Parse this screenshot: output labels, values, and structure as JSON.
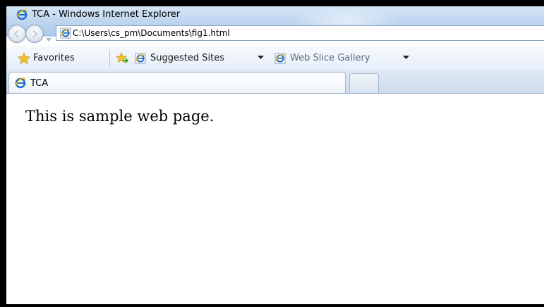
{
  "window": {
    "title": "TCA - Windows Internet Explorer"
  },
  "address_bar": {
    "url": "C:\\Users\\cs_pm\\Documents\\fig1.html"
  },
  "favorites_bar": {
    "favorites_label": "Favorites",
    "items": [
      {
        "label": "Suggested Sites",
        "icon": "ie-icon"
      },
      {
        "label": "Web Slice Gallery",
        "icon": "ie-icon"
      }
    ]
  },
  "tabs": [
    {
      "label": "TCA",
      "icon": "ie-icon",
      "active": true
    }
  ],
  "page": {
    "text": "This is sample web page."
  },
  "colors": {
    "titlebar": "#c0d7f0",
    "window_frame": "#000000",
    "content_background": "#ffffff"
  }
}
